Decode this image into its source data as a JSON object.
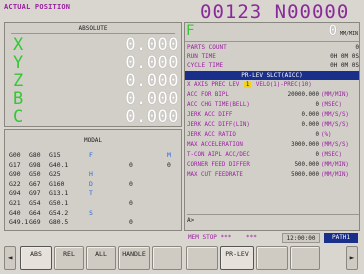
{
  "header": {
    "screen_title": "ACTUAL POSITION",
    "program_number": "00123 N00000"
  },
  "absolute": {
    "title": "ABSOLUTE",
    "axes": [
      {
        "name": "X",
        "value": "0.000"
      },
      {
        "name": "Y",
        "value": "0.000"
      },
      {
        "name": "Z",
        "value": "0.000"
      },
      {
        "name": "B",
        "value": "0.000"
      },
      {
        "name": "C",
        "value": "0.000"
      }
    ]
  },
  "modal": {
    "title": "MODAL",
    "gcodes": [
      [
        "G00",
        "G80",
        "G15"
      ],
      [
        "G17",
        "G98",
        "G40.1"
      ],
      [
        "G90",
        "G50",
        "G25"
      ],
      [
        "G22",
        "G67",
        "G160"
      ],
      [
        "G94",
        "G97",
        "G13.1"
      ],
      [
        "G21",
        "G54",
        "G50.1"
      ],
      [
        "G40",
        "G64",
        "G54.2"
      ],
      [
        "G49.1",
        "G69",
        "G80.5"
      ]
    ],
    "items": [
      {
        "label": "F",
        "value": "",
        "extra": "M"
      },
      {
        "label": "",
        "value": "0",
        "extra": "0"
      },
      {
        "label": "H",
        "value": "",
        "extra": ""
      },
      {
        "label": "D",
        "value": "0",
        "extra": ""
      },
      {
        "label": "T",
        "value": "",
        "extra": ""
      },
      {
        "label": "",
        "value": "0",
        "extra": ""
      },
      {
        "label": "S",
        "value": "",
        "extra": ""
      },
      {
        "label": "",
        "value": "0",
        "extra": ""
      }
    ]
  },
  "feed": {
    "label": "F",
    "value": "0",
    "unit": "MM/MIN"
  },
  "stats": [
    {
      "label": "PARTS COUNT",
      "value": "0"
    },
    {
      "label": "RUN TIME",
      "value": "0H 0M 0S"
    },
    {
      "label": "CYCLE TIME",
      "value": "0H 0M 0S"
    }
  ],
  "param": {
    "header": "PR-LEV SLCT(AICC)",
    "axis_line": {
      "prefix": "X   AXIS  PREC LEV",
      "selected": "1",
      "suffix": "VELO(1)-PREC(10)"
    },
    "rows": [
      {
        "label": "ACC FOR BIPL",
        "value": "20000.000",
        "unit": "(MM/MIN)"
      },
      {
        "label": "ACC CHG TIME(BELL)",
        "value": "0",
        "unit": "(MSEC)"
      },
      {
        "label": "JERK ACC DIFF",
        "value": "0.000",
        "unit": "(MM/S/S)"
      },
      {
        "label": "JERK ACC DIFF(LIN)",
        "value": "0.000",
        "unit": "(MM/S/S)"
      },
      {
        "label": "JERK ACC RATIO",
        "value": "0",
        "unit": "(%)"
      },
      {
        "label": "MAX ACCELERATION",
        "value": "3000.000",
        "unit": "(MM/S/S)"
      },
      {
        "label": "T-CON AIPL ACC/DEC",
        "value": "0",
        "unit": "(MSEC)"
      },
      {
        "label": "CORNER FEED DIFFER",
        "value": "500.000",
        "unit": "(MM/MIN)"
      },
      {
        "label": "MAX CUT FEEDRATE",
        "value": "5000.000",
        "unit": "(MM/MIN)"
      }
    ]
  },
  "input": {
    "prompt": "A>"
  },
  "status": {
    "mode": "MEM",
    "state": "STOP ***",
    "alarm": "***",
    "time": "12:00:00",
    "path": "PATH1"
  },
  "softkeys": {
    "left_arrow": "◄",
    "keys": [
      "ABS",
      "REL",
      "ALL",
      "HANDLE",
      "",
      "",
      "PR-LEV",
      "",
      ""
    ],
    "right_arrow": "►"
  },
  "colors": {
    "axis_letter": "#33c833",
    "label": "#9a1fa0",
    "header_bg": "#1a2f8a",
    "selected": "#f2d31a"
  }
}
